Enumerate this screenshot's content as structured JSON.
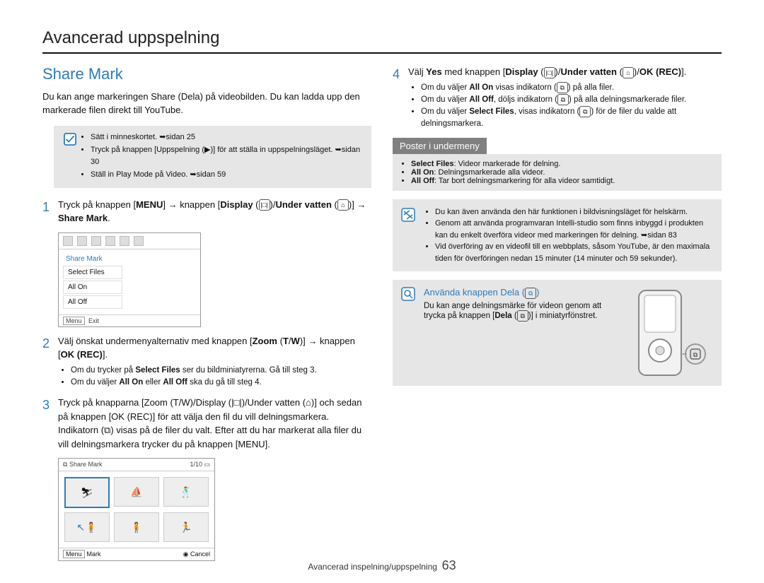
{
  "page_title": "Avancerad uppspelning",
  "section_title": "Share Mark",
  "intro": "Du kan ange markeringen Share (Dela) på videobilden. Du kan ladda upp den markerade filen direkt till YouTube.",
  "prereq": {
    "items": [
      "Sätt i minneskortet. ➥sidan 25",
      "Tryck på knappen [Uppspelning (▶)] för att ställa in uppspelningsläget. ➥sidan 30",
      "Ställ in Play Mode på Video. ➥sidan 59"
    ]
  },
  "step1": {
    "num": "1",
    "text": "Tryck på knappen [MENU] → knappen [Display (|□|)/Under vatten (⌂)] → Share Mark."
  },
  "screenshot1": {
    "head": "Share Mark",
    "items": [
      "Select Files",
      "All On",
      "All Off"
    ],
    "footer_left": "Menu",
    "footer_left2": "Exit"
  },
  "step2": {
    "num": "2",
    "text": "Välj önskat undermenyalternativ med knappen [Zoom (T/W)] → knappen [OK (REC)].",
    "bullets": [
      "Om du trycker på Select Files ser du bildminiatyrerna. Gå till steg 3.",
      "Om du väljer All On eller All Off ska du gå till steg 4."
    ]
  },
  "step3": {
    "num": "3",
    "text": "Tryck på knapparna [Zoom (T/W)/Display (|□|)/Under vatten (⌂)] och sedan på knappen [OK (REC)] för att välja den fil du vill delningsmarkera. Indikatorn (⧉) visas på de filer du valt. Efter att du har markerat alla filer du vill delningsmarkera trycker du på knappen [MENU]."
  },
  "thumbshot": {
    "top_left": "Share Mark",
    "top_right": "1/10",
    "bottom_left_label": "Menu",
    "bottom_left": "Mark",
    "bottom_right": "Cancel"
  },
  "step4": {
    "num": "4",
    "text_pre": "Välj ",
    "text_yes": "Yes",
    "text_mid": " med knappen [",
    "btn_display": "Display",
    "icon_display": "(|□|)",
    "slash": "/",
    "btn_under": "Under vatten",
    "icon_under": "(⌂)",
    "btn_ok": "OK (REC)",
    "text_end": "].",
    "bullets": [
      "Om du väljer All On visas indikatorn (⧉) på alla filer.",
      "Om du väljer All Off, döljs indikatorn (⧉) på alla delningsmarkerade filer.",
      "Om du väljer Select Files, visas indikatorn (⧉) för de filer du valde att delningsmarkera."
    ]
  },
  "submenu": {
    "header": "Poster i undermeny",
    "items": [
      "Select Files: Videor markerade för delning.",
      "All On: Delningsmarkerade alla videor.",
      "All Off: Tar bort delningsmarkering för alla videor samtidigt."
    ]
  },
  "tips": {
    "items": [
      "Du kan även använda den här funktionen i bildvisningsläget för helskärm.",
      "Genom att använda programvaran Intelli-studio som finns inbyggd i produkten kan du enkelt överföra videor med markeringen för delning. ➥sidan 83",
      "Vid överföring av en videofil till en webbplats, såsom YouTube, är den maximala tiden för överföringen nedan 15 minuter (14 minuter och 59 sekunder)."
    ]
  },
  "share_button": {
    "title": "Använda knappen Dela (⧉)",
    "text": "Du kan ange delningsmärke för videon genom att trycka på knappen [Dela (⧉)] i miniatyrfönstret."
  },
  "footer": {
    "label": "Avancerad inspelning/uppspelning",
    "page": "63"
  }
}
